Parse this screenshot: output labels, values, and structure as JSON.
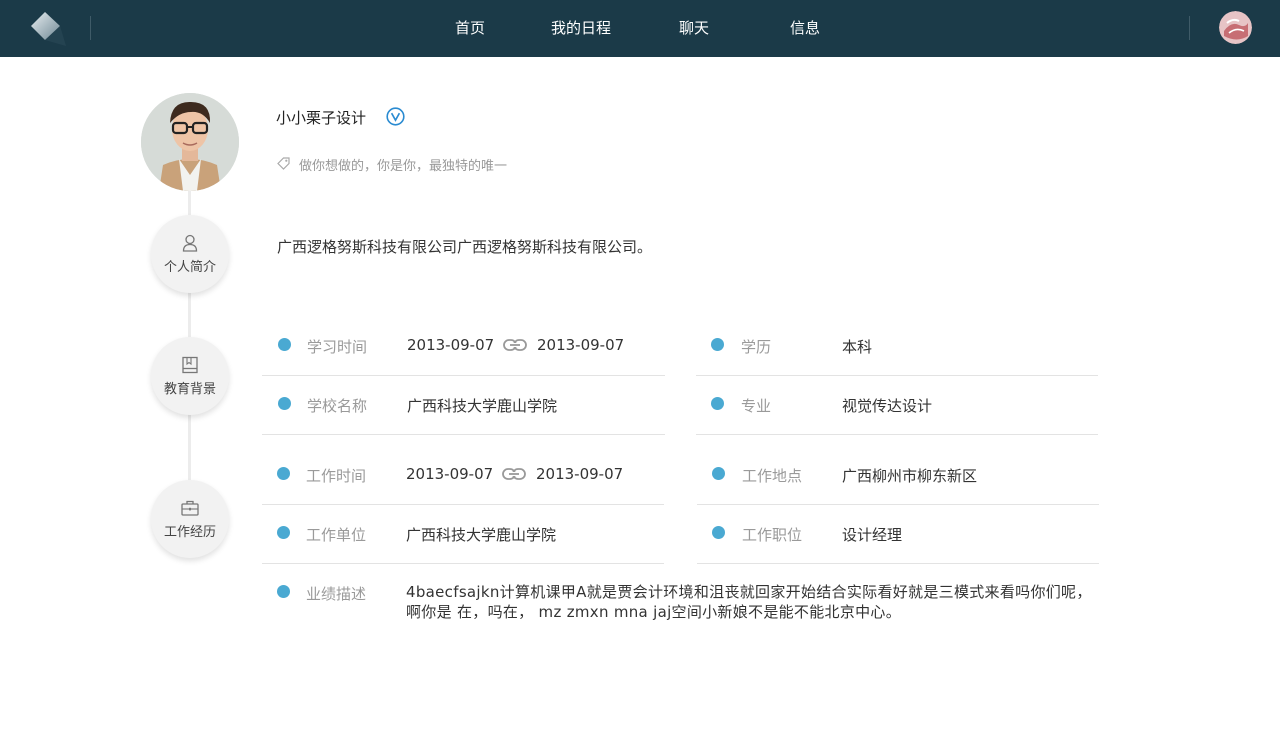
{
  "nav": {
    "items": [
      "首页",
      "我的日程",
      "聊天",
      "信息"
    ]
  },
  "profile": {
    "name": "小小栗子设计",
    "motto": "做你想做的，你是你，最独特的唯一"
  },
  "sections": {
    "intro_label": "个人简介",
    "education_label": "教育背景",
    "work_label": "工作经历"
  },
  "intro": {
    "text": "广西逻格努斯科技有限公司广西逻格努斯科技有限公司。"
  },
  "education": {
    "study_time_label": "学习时间",
    "study_start": "2013-09-07",
    "study_end": "2013-09-07",
    "degree_label": "学历",
    "degree": "本科",
    "school_label": "学校名称",
    "school": "广西科技大学鹿山学院",
    "major_label": "专业",
    "major": "视觉传达设计"
  },
  "work": {
    "work_time_label": "工作时间",
    "work_start": "2013-09-07",
    "work_end": "2013-09-07",
    "location_label": "工作地点",
    "location": "广西柳州市柳东新区",
    "company_label": "工作单位",
    "company": "广西科技大学鹿山学院",
    "position_label": "工作职位",
    "position": "设计经理",
    "performance_label": "业绩描述",
    "performance": "4baecfsajkn计算机课甲A就是贾会计环境和沮丧就回家开始结合实际看好就是三模式来看吗你们呢，啊你是 在，吗在， mz zmxn mna jaj空间小新娘不是能不能北京中心。"
  },
  "colors": {
    "topbar": "#1b3a48",
    "accent_dot": "#4aa9d2",
    "verified": "#2a8bd1"
  }
}
